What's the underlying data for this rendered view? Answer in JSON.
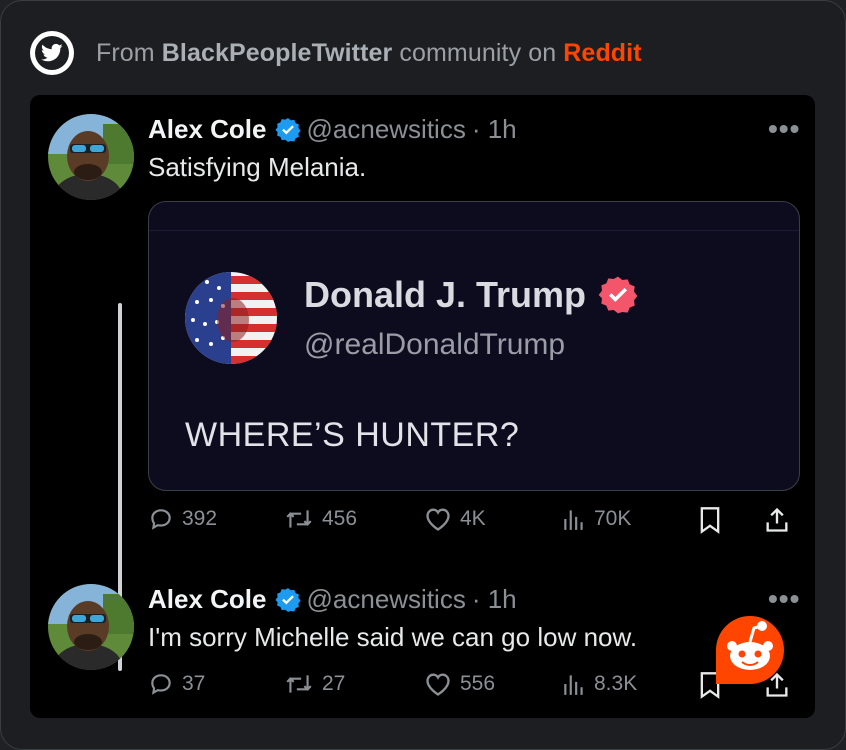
{
  "header": {
    "prefix": "From ",
    "community": "BlackPeopleTwitter",
    "middle": " community on ",
    "site": "Reddit"
  },
  "tweet1": {
    "name": "Alex Cole",
    "handle": "@acnewsitics",
    "time": "· 1h",
    "text": "Satisfying Melania.",
    "quote": {
      "name": "Donald J. Trump",
      "handle": "@realDonaldTrump",
      "text": "WHERE’S HUNTER?"
    },
    "replies": "392",
    "reposts": "456",
    "likes": "4K",
    "views": "70K"
  },
  "tweet2": {
    "name": "Alex Cole",
    "handle": "@acnewsitics",
    "time": "· 1h",
    "text": "I'm sorry Michelle said we can go low now.",
    "replies": "37",
    "reposts": "27",
    "likes": "556",
    "views": "8.3K"
  },
  "more_label": "•••",
  "colors": {
    "reddit": "#ff4500",
    "verified": "#1d9bf0",
    "trump_verified": "#f3566b"
  },
  "icons": [
    "twitter-bird-icon",
    "verified-badge-icon",
    "reply-icon",
    "repost-icon",
    "like-icon",
    "views-icon",
    "bookmark-icon",
    "share-icon",
    "reddit-snoo-icon"
  ]
}
